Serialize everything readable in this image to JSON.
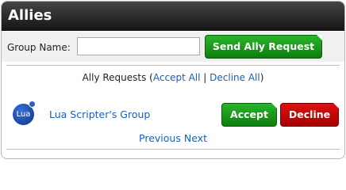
{
  "panel": {
    "title": "Allies"
  },
  "group_form": {
    "label": "Group Name:",
    "input_value": "",
    "input_placeholder": "",
    "send_button": "Send Ally Request"
  },
  "requests": {
    "prefix": "Ally Requests (",
    "accept_all": "Accept All",
    "separator": " | ",
    "decline_all": "Decline All",
    "suffix": ")"
  },
  "request_item": {
    "icon_text": "Lua",
    "group_name": "Lua Scripter's Group",
    "accept_label": "Accept",
    "decline_label": "Decline"
  },
  "pager": {
    "previous": "Previous",
    "next": "Next"
  },
  "colors": {
    "header_bg": "#141414",
    "button_green": "#0d7d0d",
    "button_red": "#a30000",
    "link_blue": "#1a5fb4"
  }
}
